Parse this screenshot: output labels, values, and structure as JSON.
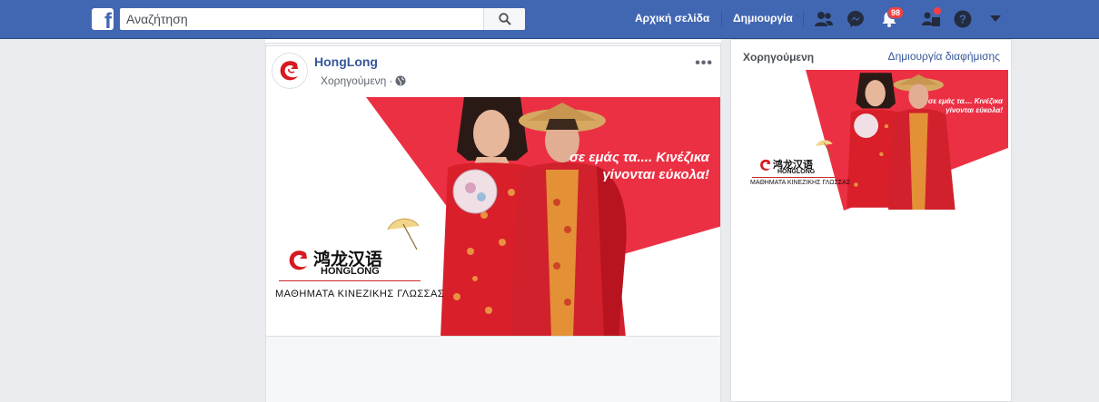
{
  "topbar": {
    "search_placeholder": "Αναζήτηση",
    "home_label": "Αρχική σελίδα",
    "create_label": "Δημιουργία",
    "notifications_count": "98",
    "brand_color": "#4267b2"
  },
  "post": {
    "page_name": "HongLong",
    "sponsored_label": "Χορηγούμενη",
    "separator": "·",
    "more_label": "•••"
  },
  "ad_creative": {
    "slogan_line1": "σε εμάς τα.... Κινέζικα",
    "slogan_line2": "γίνονται εύκολα!",
    "brand_cn": "鸿龙汉语",
    "brand_en": "HONGLONG",
    "brand_sub": "ΜΑΘΗΜΑΤΑ ΚΙΝΕΖΙΚΗΣ ΓΛΩΣΣΑΣ",
    "accent_color": "#ec3044"
  },
  "sidebar": {
    "title": "Χορηγούμενη",
    "create_ad_link": "Δημιουργία διαφήμισης"
  }
}
